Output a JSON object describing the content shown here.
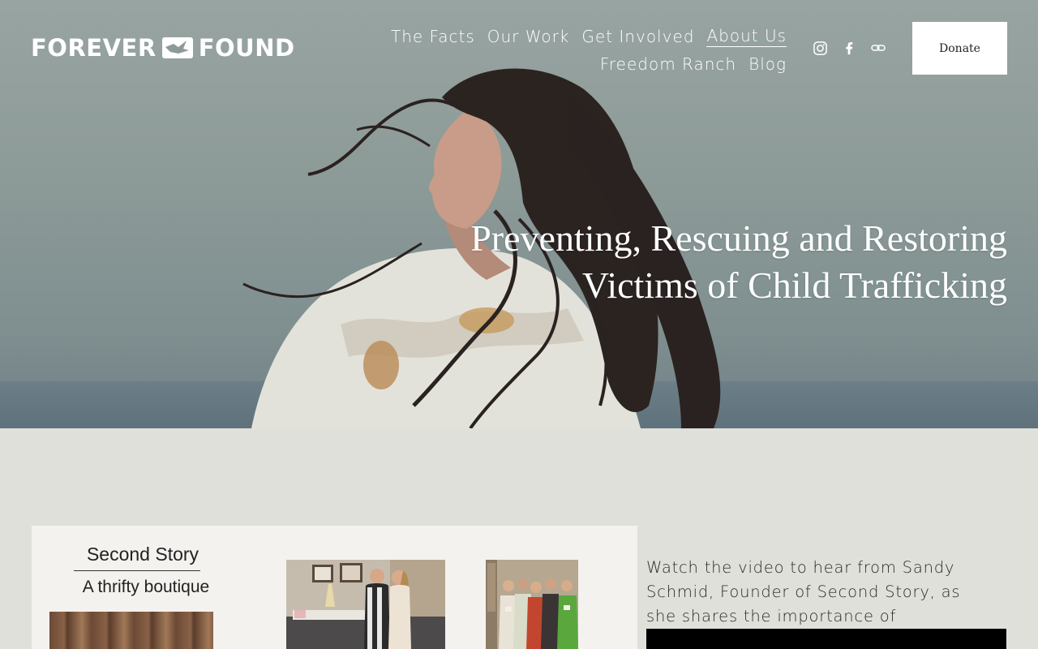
{
  "brand": {
    "name_left": "FOREVER",
    "name_right": "FOUND",
    "logo_icon": "bird-in-box-icon"
  },
  "nav": {
    "row1": [
      {
        "label": "The Facts",
        "active": false
      },
      {
        "label": "Our Work",
        "active": false
      },
      {
        "label": "Get Involved",
        "active": false
      },
      {
        "label": "About Us",
        "active": true
      }
    ],
    "row2": [
      {
        "label": "Freedom Ranch",
        "active": false
      },
      {
        "label": "Blog",
        "active": false
      }
    ]
  },
  "socials": [
    "instagram-icon",
    "facebook-icon",
    "link-icon"
  ],
  "donate_label": "Donate",
  "hero": {
    "line1": "Preventing, Rescuing and Restoring",
    "line2": "Victims of Child Trafficking"
  },
  "collage": {
    "title": "Second Story",
    "subtitle": "A thrifty boutique"
  },
  "video_intro": "Watch the video to hear from Sandy Schmid, Founder of Second Story, as she shares the importance of",
  "colors": {
    "page_bg": "#dfe0da",
    "button_bg": "#ffffff",
    "text_dark": "#2a2a2a",
    "hero_text": "#ffffff"
  }
}
